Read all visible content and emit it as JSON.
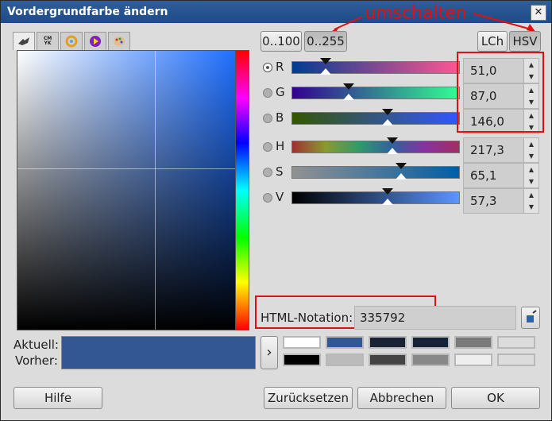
{
  "window": {
    "title": "Vordergrundfarbe ändern",
    "close_glyph": "✕"
  },
  "annotation": {
    "text": "umschalten",
    "color": "#e01010"
  },
  "range_buttons": [
    {
      "label": "0..100",
      "pressed": false
    },
    {
      "label": "0..255",
      "pressed": true
    }
  ],
  "model_buttons": [
    {
      "label": "LCh",
      "pressed": false
    },
    {
      "label": "HSV",
      "pressed": true
    }
  ],
  "channels": [
    {
      "label": "R",
      "value": "51,0",
      "selected": true,
      "fraction": 0.2,
      "gradient": [
        "#003c92",
        "#ff5792"
      ]
    },
    {
      "label": "G",
      "value": "87,0",
      "selected": false,
      "fraction": 0.34,
      "gradient": [
        "#330092",
        "#33ff92"
      ]
    },
    {
      "label": "B",
      "value": "146,0",
      "selected": false,
      "fraction": 0.57,
      "gradient": [
        "#335700",
        "#3357ff"
      ]
    },
    {
      "label": "H",
      "value": "217,3",
      "selected": false,
      "fraction": 0.6,
      "gradient": [
        "#a03030",
        "#8a9a30",
        "#309a6a",
        "#3060a0",
        "#8a30a0",
        "#a03060"
      ]
    },
    {
      "label": "S",
      "value": "65,1",
      "selected": false,
      "fraction": 0.65,
      "gradient": [
        "#929292",
        "#005ea6"
      ]
    },
    {
      "label": "V",
      "value": "57,3",
      "selected": false,
      "fraction": 0.57,
      "gradient": [
        "#000000",
        "#5a96ff"
      ]
    }
  ],
  "html_notation": {
    "label": "HTML-Notation:",
    "value": "335792"
  },
  "current": {
    "label_current": "Aktuell:",
    "label_previous": "Vorher:",
    "color": "#335792"
  },
  "history_colors": {
    "top": [
      "#ffffff",
      "#335792",
      "#1a2236",
      "#152238",
      "#7a7a7a",
      "#dcdcdc"
    ],
    "bottom": [
      "#000000",
      "#bbbbbb",
      "#444444",
      "#888888",
      "#eeeeee",
      "#dcdcdc"
    ]
  },
  "tab_icons": [
    "wilber-icon",
    "cmyk-icon",
    "wheel-icon",
    "triangle-icon",
    "palette-icon"
  ],
  "tab_icon_text": {
    "cmyk": "CMYK"
  },
  "footer": {
    "help": "Hilfe",
    "reset": "Zurücksetzen",
    "cancel": "Abbrechen",
    "ok": "OK"
  },
  "arrow_glyph": "›"
}
